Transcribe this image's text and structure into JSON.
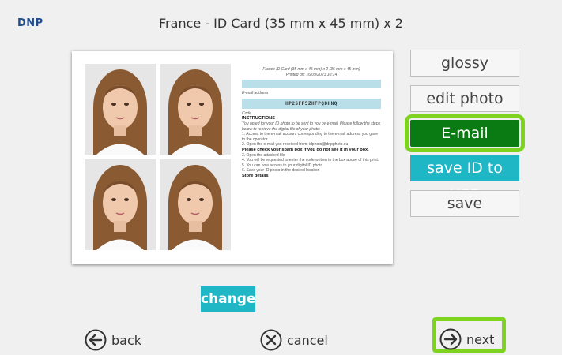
{
  "header": {
    "brand": "DNP",
    "title": "France - ID Card (35 mm x 45 mm) x 2"
  },
  "sheet": {
    "heading_line1": "France ID Card (35 mm x 45 mm) x 2 (35 mm x 45 mm)",
    "heading_line2": "Printed on: 16/09/2021 10:14",
    "email_label": "E-mail address",
    "code": "HP2SFP5ZHFPQDHNQ",
    "code_label": "Code",
    "instructions_title": "INSTRUCTIONS",
    "intro": "You opted for your ID photo to be sent to you by e-mail. Please follow the steps below to retrieve the digital file of your photo:",
    "step1": "1. Access to the e-mail account corresponding to the e-mail address you gave to the operator",
    "step2": "2. Open the e-mail you received from: idphoto@dnpphoto.eu",
    "spam": "Please check your spam box if you do not see it in your box.",
    "step3": "3. Open the attached file",
    "step4": "4. You will be requested to enter the code written in the box above of this print.",
    "step5": "5. You can now access to your digital ID photo",
    "step6": "6. Save your ID photo in the desired location",
    "store": "Store details"
  },
  "buttons": {
    "glossy": "glossy",
    "edit_photo": "edit photo",
    "email": "E-mail",
    "save_usb": "save ID to USB",
    "save": "save",
    "change": "change"
  },
  "nav": {
    "back": "back",
    "cancel": "cancel",
    "next": "next"
  },
  "colors": {
    "email_bg": "#0a7a12",
    "highlight": "#7ed321",
    "accent": "#1fb6c5"
  }
}
